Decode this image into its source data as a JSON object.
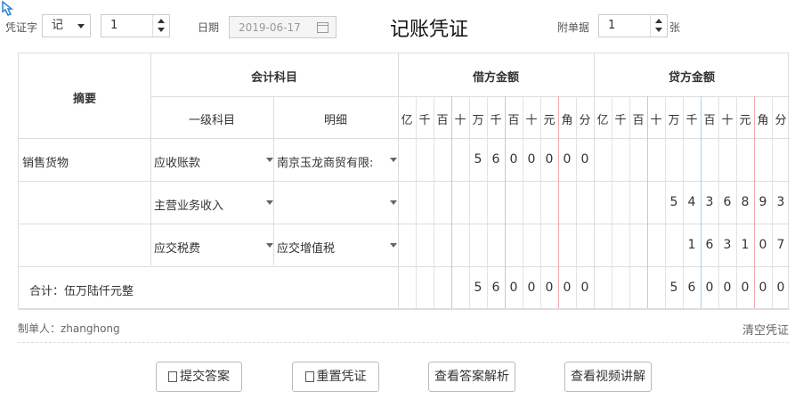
{
  "header": {
    "voucher_type_label": "凭证字",
    "voucher_type_value": "记",
    "voucher_number_value": "1",
    "date_label": "日期",
    "date_value": "2019-06-17",
    "title": "记账凭证",
    "attachments_label": "附单据",
    "attachments_value": "1",
    "attachments_unit": "张"
  },
  "table": {
    "col_summary": "摘要",
    "col_account": "会计科目",
    "col_account_primary": "一级科目",
    "col_account_detail": "明细",
    "col_debit": "借方金额",
    "col_credit": "贷方金额",
    "digit_units": [
      "亿",
      "千",
      "百",
      "十",
      "万",
      "千",
      "百",
      "十",
      "元",
      "角",
      "分"
    ],
    "rows": [
      {
        "summary": "销售货物",
        "primary": "应收账款",
        "detail": "南京玉龙商贸有限:",
        "debit": [
          "",
          "",
          "",
          "",
          "5",
          "6",
          "0",
          "0",
          "0",
          "0",
          "0"
        ],
        "credit": [
          "",
          "",
          "",
          "",
          "",
          "",
          "",
          "",
          "",
          "",
          ""
        ]
      },
      {
        "summary": "",
        "primary": "主营业务收入",
        "detail": "",
        "debit": [
          "",
          "",
          "",
          "",
          "",
          "",
          "",
          "",
          "",
          "",
          ""
        ],
        "credit": [
          "",
          "",
          "",
          "",
          "5",
          "4",
          "3",
          "6",
          "8",
          "9",
          "3"
        ]
      },
      {
        "summary": "",
        "primary": "应交税费",
        "detail": "应交增值税",
        "debit": [
          "",
          "",
          "",
          "",
          "",
          "",
          "",
          "",
          "",
          "",
          ""
        ],
        "credit": [
          "",
          "",
          "",
          "",
          "",
          "",
          "1",
          "6",
          "3",
          "1",
          "0",
          "7"
        ]
      }
    ],
    "total_label": "合计：伍万陆仟元整",
    "total_debit": [
      "",
      "",
      "",
      "",
      "5",
      "6",
      "0",
      "0",
      "0",
      "0",
      "0"
    ],
    "total_credit": [
      "",
      "",
      "",
      "",
      "5",
      "6",
      "0",
      "0",
      "0",
      "0",
      "0"
    ]
  },
  "footer": {
    "maker_label": "制单人：zhanghong",
    "clear_label": "清空凭证",
    "buttons": {
      "submit": "提交答案",
      "reset": "重置凭证",
      "view_answer": "查看答案解析",
      "view_video": "查看视频讲解"
    }
  }
}
